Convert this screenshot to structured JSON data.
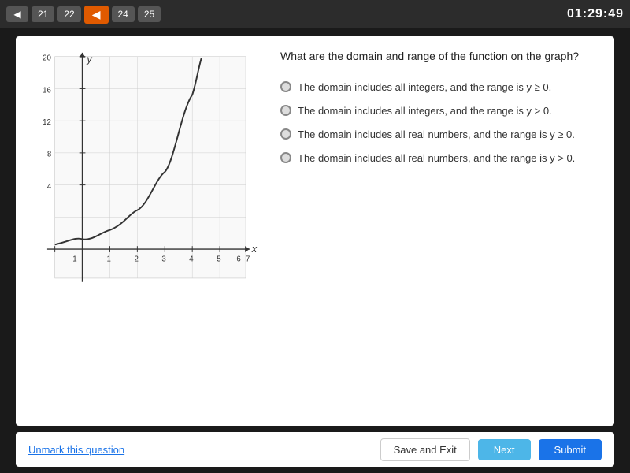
{
  "topbar": {
    "timer": "01:29:49",
    "nav_items": [
      "21",
      "22",
      "24",
      "25"
    ],
    "back_arrow": "◀"
  },
  "question": {
    "text": "What are the domain and range of the function on the graph?",
    "options": [
      {
        "id": "A",
        "text": "The domain includes all integers, and the range is y ≥ 0."
      },
      {
        "id": "B",
        "text": "The domain includes all integers, and the range is y > 0."
      },
      {
        "id": "C",
        "text": "The domain includes all real numbers, and the range is y ≥ 0."
      },
      {
        "id": "D",
        "text": "The domain includes all real numbers, and the range is y > 0."
      }
    ]
  },
  "graph": {
    "y_label": "y",
    "x_label": "x",
    "y_axis_values": [
      "20",
      "16",
      "12",
      "8",
      "4"
    ],
    "x_axis_values": [
      "-1",
      "1",
      "2",
      "3",
      "4",
      "5",
      "6",
      "7"
    ]
  },
  "footer": {
    "unmark_label": "Unmark this question",
    "save_exit_label": "Save and Exit",
    "next_label": "Next",
    "submit_label": "Submit"
  }
}
